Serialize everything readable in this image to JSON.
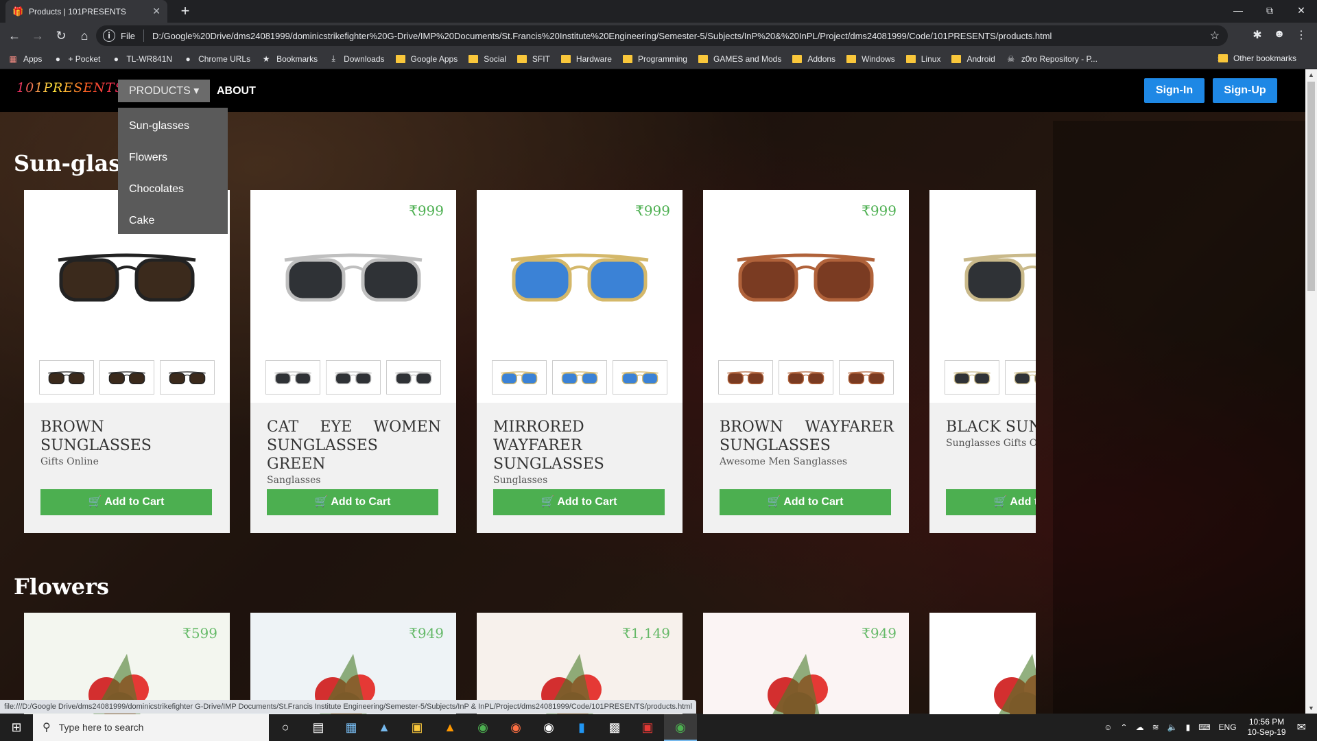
{
  "browser": {
    "tab_title": "Products | 101PRESENTS",
    "new_tab": "+",
    "url_scheme": "File",
    "url": "D:/Google%20Drive/dms24081999/dominicstrikefighter%20G-Drive/IMP%20Documents/St.Francis%20Institute%20Engineering/Semester-5/Subjects/InP%20&%20InPL/Project/dms24081999/Code/101PRESENTS/products.html",
    "status_url": "file:///D:/Google Drive/dms24081999/dominicstrikefighter G-Drive/IMP Documents/St.Francis Institute Engineering/Semester-5/Subjects/InP & InPL/Project/dms24081999/Code/101PRESENTS/products.html"
  },
  "bookmarks": {
    "items": [
      {
        "label": "Apps",
        "icon": "apps-grid-icon"
      },
      {
        "label": "+ Pocket",
        "icon": "globe-icon"
      },
      {
        "label": "TL-WR841N",
        "icon": "globe-icon"
      },
      {
        "label": "Chrome URLs",
        "icon": "globe-icon"
      },
      {
        "label": "Bookmarks",
        "icon": "star-icon"
      },
      {
        "label": "Downloads",
        "icon": "download-icon"
      },
      {
        "label": "Google Apps",
        "icon": "folder-icon"
      },
      {
        "label": "Social",
        "icon": "folder-icon"
      },
      {
        "label": "SFIT",
        "icon": "folder-icon"
      },
      {
        "label": "Hardware",
        "icon": "folder-icon"
      },
      {
        "label": "Programming",
        "icon": "folder-icon"
      },
      {
        "label": "GAMES and Mods",
        "icon": "folder-icon"
      },
      {
        "label": "Addons",
        "icon": "folder-icon"
      },
      {
        "label": "Windows",
        "icon": "folder-icon"
      },
      {
        "label": "Linux",
        "icon": "folder-icon"
      },
      {
        "label": "Android",
        "icon": "folder-icon"
      },
      {
        "label": "z0ro Repository - P...",
        "icon": "skull-icon"
      }
    ],
    "more": "»",
    "other": "Other bookmarks"
  },
  "site": {
    "logo": "101PRESENTS",
    "nav": {
      "products": "PRODUCTS",
      "about": "ABOUT",
      "signin": "Sign-In",
      "signup": "Sign-Up"
    },
    "dropdown": [
      "Sun-glasses",
      "Flowers",
      "Chocolates",
      "Cake"
    ],
    "sections": {
      "sunglasses": "Sun-glasses",
      "flowers": "Flowers"
    },
    "add_to_cart": "Add to Cart",
    "sunglasses": [
      {
        "name": "BROWN SUNGLASSES",
        "sub": "Gifts Online",
        "price": "",
        "lens": "#3b2a1c",
        "frame": "#222222"
      },
      {
        "name": "CAT EYE WOMEN SUNGLASSES GREEN",
        "sub": "Sanglasses",
        "price": "₹999",
        "lens": "#2f3236",
        "frame": "#bfbfbf"
      },
      {
        "name": "MIRRORED WAYFARER SUNGLASSES",
        "sub": "Sunglasses",
        "price": "₹999",
        "lens": "#3b82d6",
        "frame": "#d4b86a"
      },
      {
        "name": "BROWN WAYFARER SUNGLASSES",
        "sub": "Awesome Men Sanglasses",
        "price": "₹999",
        "lens": "#7a3b22",
        "frame": "#b0623a"
      },
      {
        "name": "BLACK SUNGLASSES",
        "sub": "Sunglasses Gifts Online",
        "price": "",
        "lens": "#2f3236",
        "frame": "#c9b98a"
      }
    ],
    "flowers": [
      {
        "price": "₹599"
      },
      {
        "price": "₹949"
      },
      {
        "price": "₹1,149"
      },
      {
        "price": "₹949"
      },
      {
        "price": ""
      }
    ]
  },
  "taskbar": {
    "search_placeholder": "Type here to search",
    "lang": "ENG",
    "time": "10:56 PM",
    "date": "10-Sep-19"
  }
}
